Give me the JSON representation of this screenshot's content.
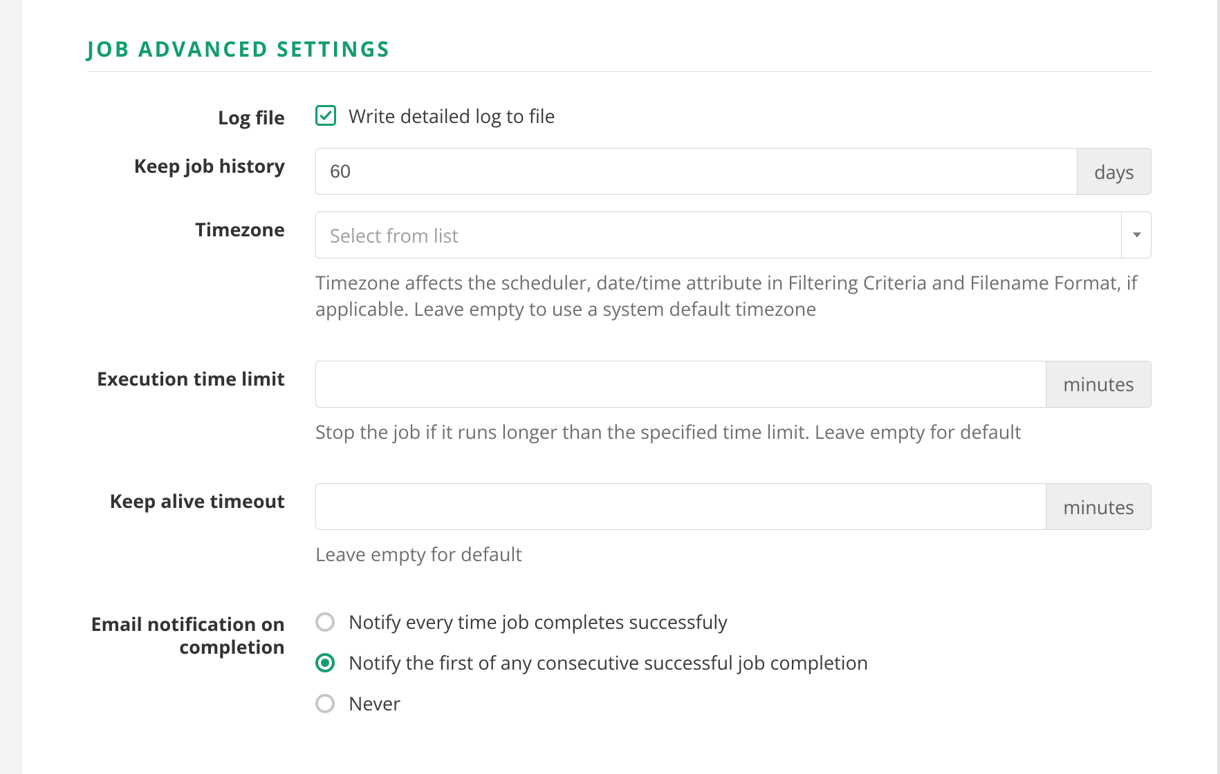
{
  "section_title": "JOB ADVANCED SETTINGS",
  "log_file": {
    "label": "Log file",
    "checkbox_label": "Write detailed log to file",
    "checked": true
  },
  "keep_history": {
    "label": "Keep job history",
    "value": "60",
    "unit": "days"
  },
  "timezone": {
    "label": "Timezone",
    "placeholder": "Select from list",
    "help": "Timezone affects the scheduler, date/time attribute in Filtering Criteria and Filename Format, if applicable. Leave empty to use a system default timezone"
  },
  "exec_limit": {
    "label": "Execution time limit",
    "value": "",
    "unit": "minutes",
    "help": "Stop the job if it runs longer than the specified time limit. Leave empty for default"
  },
  "keep_alive": {
    "label": "Keep alive timeout",
    "value": "",
    "unit": "minutes",
    "help": "Leave empty for default"
  },
  "email_notify": {
    "label": "Email notification on completion",
    "options": [
      {
        "label": "Notify every time job completes successfuly",
        "selected": false
      },
      {
        "label": "Notify the first of any consecutive successful job completion",
        "selected": true
      },
      {
        "label": "Never",
        "selected": false
      }
    ]
  }
}
